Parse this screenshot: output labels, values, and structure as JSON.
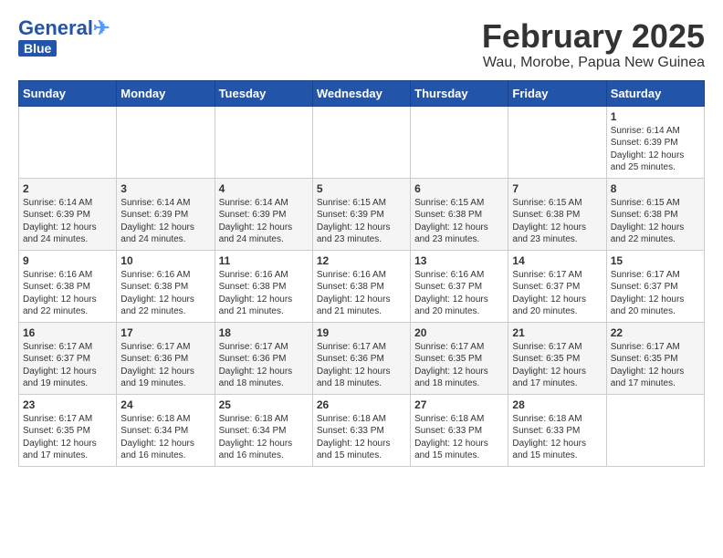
{
  "header": {
    "logo_general": "General",
    "logo_blue": "Blue",
    "title": "February 2025",
    "subtitle": "Wau, Morobe, Papua New Guinea"
  },
  "weekdays": [
    "Sunday",
    "Monday",
    "Tuesday",
    "Wednesday",
    "Thursday",
    "Friday",
    "Saturday"
  ],
  "weeks": [
    [
      {
        "day": "",
        "info": ""
      },
      {
        "day": "",
        "info": ""
      },
      {
        "day": "",
        "info": ""
      },
      {
        "day": "",
        "info": ""
      },
      {
        "day": "",
        "info": ""
      },
      {
        "day": "",
        "info": ""
      },
      {
        "day": "1",
        "info": "Sunrise: 6:14 AM\nSunset: 6:39 PM\nDaylight: 12 hours\nand 25 minutes."
      }
    ],
    [
      {
        "day": "2",
        "info": "Sunrise: 6:14 AM\nSunset: 6:39 PM\nDaylight: 12 hours\nand 24 minutes."
      },
      {
        "day": "3",
        "info": "Sunrise: 6:14 AM\nSunset: 6:39 PM\nDaylight: 12 hours\nand 24 minutes."
      },
      {
        "day": "4",
        "info": "Sunrise: 6:14 AM\nSunset: 6:39 PM\nDaylight: 12 hours\nand 24 minutes."
      },
      {
        "day": "5",
        "info": "Sunrise: 6:15 AM\nSunset: 6:39 PM\nDaylight: 12 hours\nand 23 minutes."
      },
      {
        "day": "6",
        "info": "Sunrise: 6:15 AM\nSunset: 6:38 PM\nDaylight: 12 hours\nand 23 minutes."
      },
      {
        "day": "7",
        "info": "Sunrise: 6:15 AM\nSunset: 6:38 PM\nDaylight: 12 hours\nand 23 minutes."
      },
      {
        "day": "8",
        "info": "Sunrise: 6:15 AM\nSunset: 6:38 PM\nDaylight: 12 hours\nand 22 minutes."
      }
    ],
    [
      {
        "day": "9",
        "info": "Sunrise: 6:16 AM\nSunset: 6:38 PM\nDaylight: 12 hours\nand 22 minutes."
      },
      {
        "day": "10",
        "info": "Sunrise: 6:16 AM\nSunset: 6:38 PM\nDaylight: 12 hours\nand 22 minutes."
      },
      {
        "day": "11",
        "info": "Sunrise: 6:16 AM\nSunset: 6:38 PM\nDaylight: 12 hours\nand 21 minutes."
      },
      {
        "day": "12",
        "info": "Sunrise: 6:16 AM\nSunset: 6:38 PM\nDaylight: 12 hours\nand 21 minutes."
      },
      {
        "day": "13",
        "info": "Sunrise: 6:16 AM\nSunset: 6:37 PM\nDaylight: 12 hours\nand 20 minutes."
      },
      {
        "day": "14",
        "info": "Sunrise: 6:17 AM\nSunset: 6:37 PM\nDaylight: 12 hours\nand 20 minutes."
      },
      {
        "day": "15",
        "info": "Sunrise: 6:17 AM\nSunset: 6:37 PM\nDaylight: 12 hours\nand 20 minutes."
      }
    ],
    [
      {
        "day": "16",
        "info": "Sunrise: 6:17 AM\nSunset: 6:37 PM\nDaylight: 12 hours\nand 19 minutes."
      },
      {
        "day": "17",
        "info": "Sunrise: 6:17 AM\nSunset: 6:36 PM\nDaylight: 12 hours\nand 19 minutes."
      },
      {
        "day": "18",
        "info": "Sunrise: 6:17 AM\nSunset: 6:36 PM\nDaylight: 12 hours\nand 18 minutes."
      },
      {
        "day": "19",
        "info": "Sunrise: 6:17 AM\nSunset: 6:36 PM\nDaylight: 12 hours\nand 18 minutes."
      },
      {
        "day": "20",
        "info": "Sunrise: 6:17 AM\nSunset: 6:35 PM\nDaylight: 12 hours\nand 18 minutes."
      },
      {
        "day": "21",
        "info": "Sunrise: 6:17 AM\nSunset: 6:35 PM\nDaylight: 12 hours\nand 17 minutes."
      },
      {
        "day": "22",
        "info": "Sunrise: 6:17 AM\nSunset: 6:35 PM\nDaylight: 12 hours\nand 17 minutes."
      }
    ],
    [
      {
        "day": "23",
        "info": "Sunrise: 6:17 AM\nSunset: 6:35 PM\nDaylight: 12 hours\nand 17 minutes."
      },
      {
        "day": "24",
        "info": "Sunrise: 6:18 AM\nSunset: 6:34 PM\nDaylight: 12 hours\nand 16 minutes."
      },
      {
        "day": "25",
        "info": "Sunrise: 6:18 AM\nSunset: 6:34 PM\nDaylight: 12 hours\nand 16 minutes."
      },
      {
        "day": "26",
        "info": "Sunrise: 6:18 AM\nSunset: 6:33 PM\nDaylight: 12 hours\nand 15 minutes."
      },
      {
        "day": "27",
        "info": "Sunrise: 6:18 AM\nSunset: 6:33 PM\nDaylight: 12 hours\nand 15 minutes."
      },
      {
        "day": "28",
        "info": "Sunrise: 6:18 AM\nSunset: 6:33 PM\nDaylight: 12 hours\nand 15 minutes."
      },
      {
        "day": "",
        "info": ""
      }
    ]
  ]
}
